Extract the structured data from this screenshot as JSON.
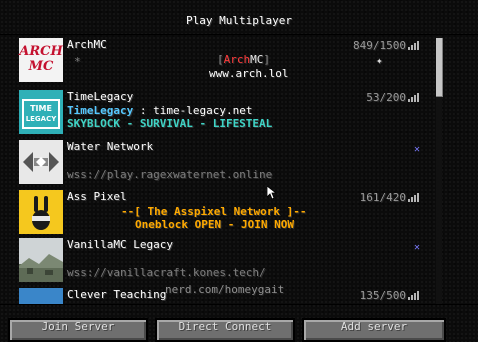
{
  "screen": {
    "title": "Play Multiplayer"
  },
  "servers": [
    {
      "name": "ArchMC",
      "count": "849/1500",
      "logo_text": [
        "ARCH",
        "MC"
      ],
      "motd": [
        {
          "parts": [
            {
              "text": "[",
              "color": "#8a8a8a"
            },
            {
              "text": "Arch",
              "color": "#ff3a3a"
            },
            {
              "text": "MC",
              "color": "#eaeaea"
            },
            {
              "text": "]",
              "color": "#8a8a8a"
            }
          ]
        },
        {
          "parts": [
            {
              "text": "www.arch.lol",
              "color": "#ffffff"
            }
          ]
        }
      ],
      "motd_decor": [
        "*",
        "✦"
      ]
    },
    {
      "name": "TimeLegacy",
      "count": "53/200",
      "logo_text": [
        "TIME",
        "LEGACY"
      ],
      "motd": [
        {
          "parts": [
            {
              "text": "TimeLegacy",
              "color": "#55c8ff",
              "bold": true
            },
            {
              "text": " : time-legacy.net",
              "color": "#ffffff"
            }
          ]
        },
        {
          "parts": [
            {
              "text": "SKYBLOCK - SURVIVAL - LIFESTEAL",
              "color": "#3fd4c6",
              "bold": true
            }
          ]
        }
      ]
    },
    {
      "name": "Water Network",
      "count": "",
      "logo_text": [],
      "motd": [
        {
          "parts": []
        },
        {
          "parts": [
            {
              "text": "wss://play.ragexwaternet.online",
              "color": "#7c7c7c"
            }
          ]
        }
      ],
      "no_connection": true
    },
    {
      "name": "Ass Pixel",
      "count": "161/420",
      "logo_text": [],
      "motd": [
        {
          "parts": [
            {
              "text": "--[ ",
              "color": "#ffaa00",
              "bold": true
            },
            {
              "text": "The Asspixel Network",
              "color": "#ffaa00",
              "bold": true
            },
            {
              "text": " ]--",
              "color": "#ffaa00",
              "bold": true
            }
          ]
        },
        {
          "parts": [
            {
              "text": "Oneblock OPEN - JOIN NOW",
              "color": "#ffaa00",
              "bold": true
            }
          ]
        }
      ]
    },
    {
      "name": "VanillaMC Legacy",
      "count": "",
      "logo_text": [],
      "motd": [
        {
          "parts": []
        },
        {
          "parts": [
            {
              "text": "wss://vanillacraft.kones.tech/",
              "color": "#7c7c7c"
            }
          ]
        }
      ],
      "no_connection": true
    },
    {
      "name": "Clever Teaching",
      "count": "135/500",
      "logo_text": [],
      "motd": []
    }
  ],
  "overlay_text": "nerd.com/homeygait",
  "buttons": {
    "join": "Join Server",
    "direct": "Direct Connect",
    "add": "Add server"
  },
  "icons": {
    "signal": "signal-bars-icon",
    "no_connection": "no-connection-icon",
    "cursor": "mouse-cursor-icon"
  }
}
